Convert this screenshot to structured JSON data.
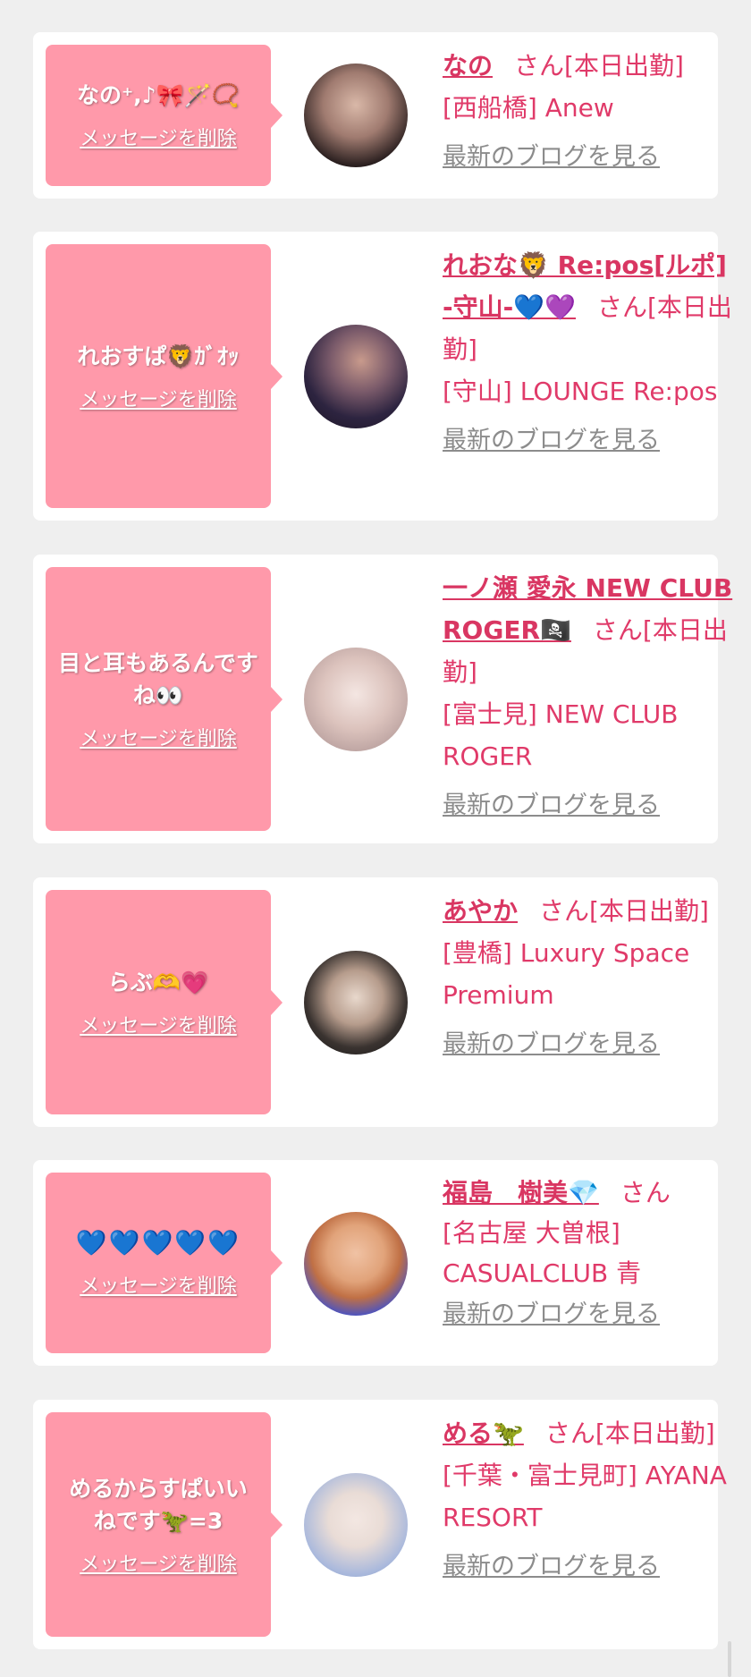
{
  "cards": [
    {
      "message": "なの⁺,♪🎀🪄📿",
      "delete_label": "メッセージを削除",
      "cast_name": "なの",
      "honorific": "さん[本日出勤]",
      "shop": "[西船橋] Anew",
      "blog_label": "最新のブログを見る",
      "avatar_colors": [
        "#d9b8a8",
        "#2a1f1f"
      ]
    },
    {
      "message": "れおすぱ🦁ｶﾞｵｯ",
      "delete_label": "メッセージを削除",
      "cast_name": "れおな🦁 Re:pos[ルポ] -守山-💙💜",
      "honorific": "さん[本日出勤]",
      "shop": "[守山] LOUNGE Re:pos",
      "blog_label": "最新のブログを見る",
      "avatar_colors": [
        "#7a5a6a",
        "#1c1422"
      ]
    },
    {
      "message": "目と耳もあるんですね👀",
      "delete_label": "メッセージを削除",
      "cast_name": "一ノ瀬 愛永 NEW CLUB ROGER🏴‍☠️",
      "honorific": "さん[本日出勤]",
      "shop": "[富士見] NEW CLUB ROGER",
      "blog_label": "最新のブログを見る",
      "avatar_colors": [
        "#f1e9ea",
        "#b9a09e"
      ]
    },
    {
      "message": "らぶ🫶💗",
      "delete_label": "メッセージを削除",
      "cast_name": "あやか",
      "honorific": "さん[本日出勤]",
      "shop": "[豊橋] Luxury Space Premium",
      "blog_label": "最新のブログを見る",
      "avatar_colors": [
        "#cfc0b4",
        "#121212"
      ]
    },
    {
      "message": "💙💙💙💙💙",
      "delete_label": "メッセージを削除",
      "cast_name": "福島　樹美💎",
      "honorific": "さん",
      "shop": "[名古屋 大曽根] CASUALCLUB 青",
      "blog_label": "最新のブログを見る",
      "avatar_colors": [
        "#e1a37a",
        "#3c4fd0"
      ]
    },
    {
      "message": "めるからすぱいいねです🦖=3",
      "delete_label": "メッセージを削除",
      "cast_name": "める🦖",
      "honorific": "さん[本日出勤]",
      "shop": "[千葉・富士見町] AYANA RESORT",
      "blog_label": "最新のブログを見る",
      "avatar_colors": [
        "#aab9dc",
        "#e9dcd6"
      ]
    }
  ]
}
